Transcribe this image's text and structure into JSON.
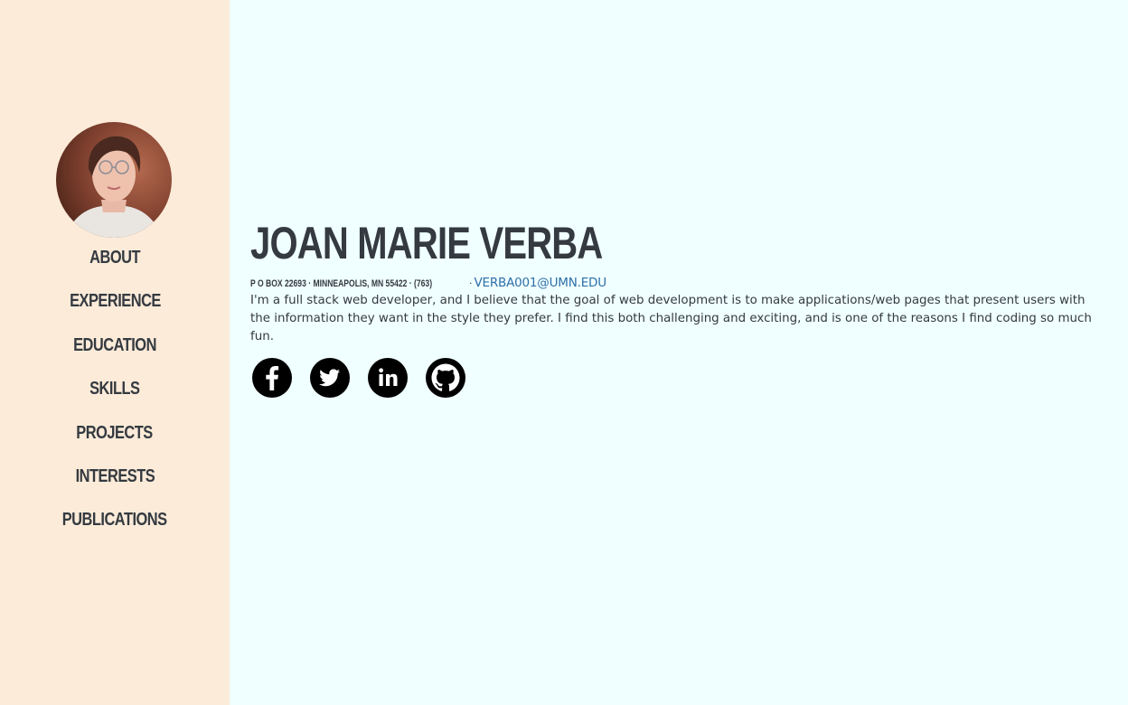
{
  "sidebar": {
    "avatar_alt": "profile photo",
    "nav": [
      {
        "label": "About"
      },
      {
        "label": "Experience"
      },
      {
        "label": "Education"
      },
      {
        "label": "Skills"
      },
      {
        "label": "Projects"
      },
      {
        "label": "Interests"
      },
      {
        "label": "Publications"
      }
    ],
    "bg_color": "#fcebd9"
  },
  "main": {
    "name": "Joan Marie Verba",
    "contact": {
      "address": "P O BOX 22693 · MINNEAPOLIS, MN 55422 · (763)",
      "separator": "·",
      "email": "VERBA001@UMN.EDU"
    },
    "lead": "I'm a full stack web developer, and I believe that the goal of web development is to make applications/web pages that present users with the information they want in the style they prefer. I find this both challenging and exciting, and is one of the reasons I find coding so much fun.",
    "social": [
      {
        "icon": "facebook-icon"
      },
      {
        "icon": "twitter-icon"
      },
      {
        "icon": "linkedin-icon"
      },
      {
        "icon": "github-icon"
      }
    ],
    "bg_color": "#f0ffff",
    "text_color": "#343a40",
    "link_color": "#2e6fa8"
  }
}
